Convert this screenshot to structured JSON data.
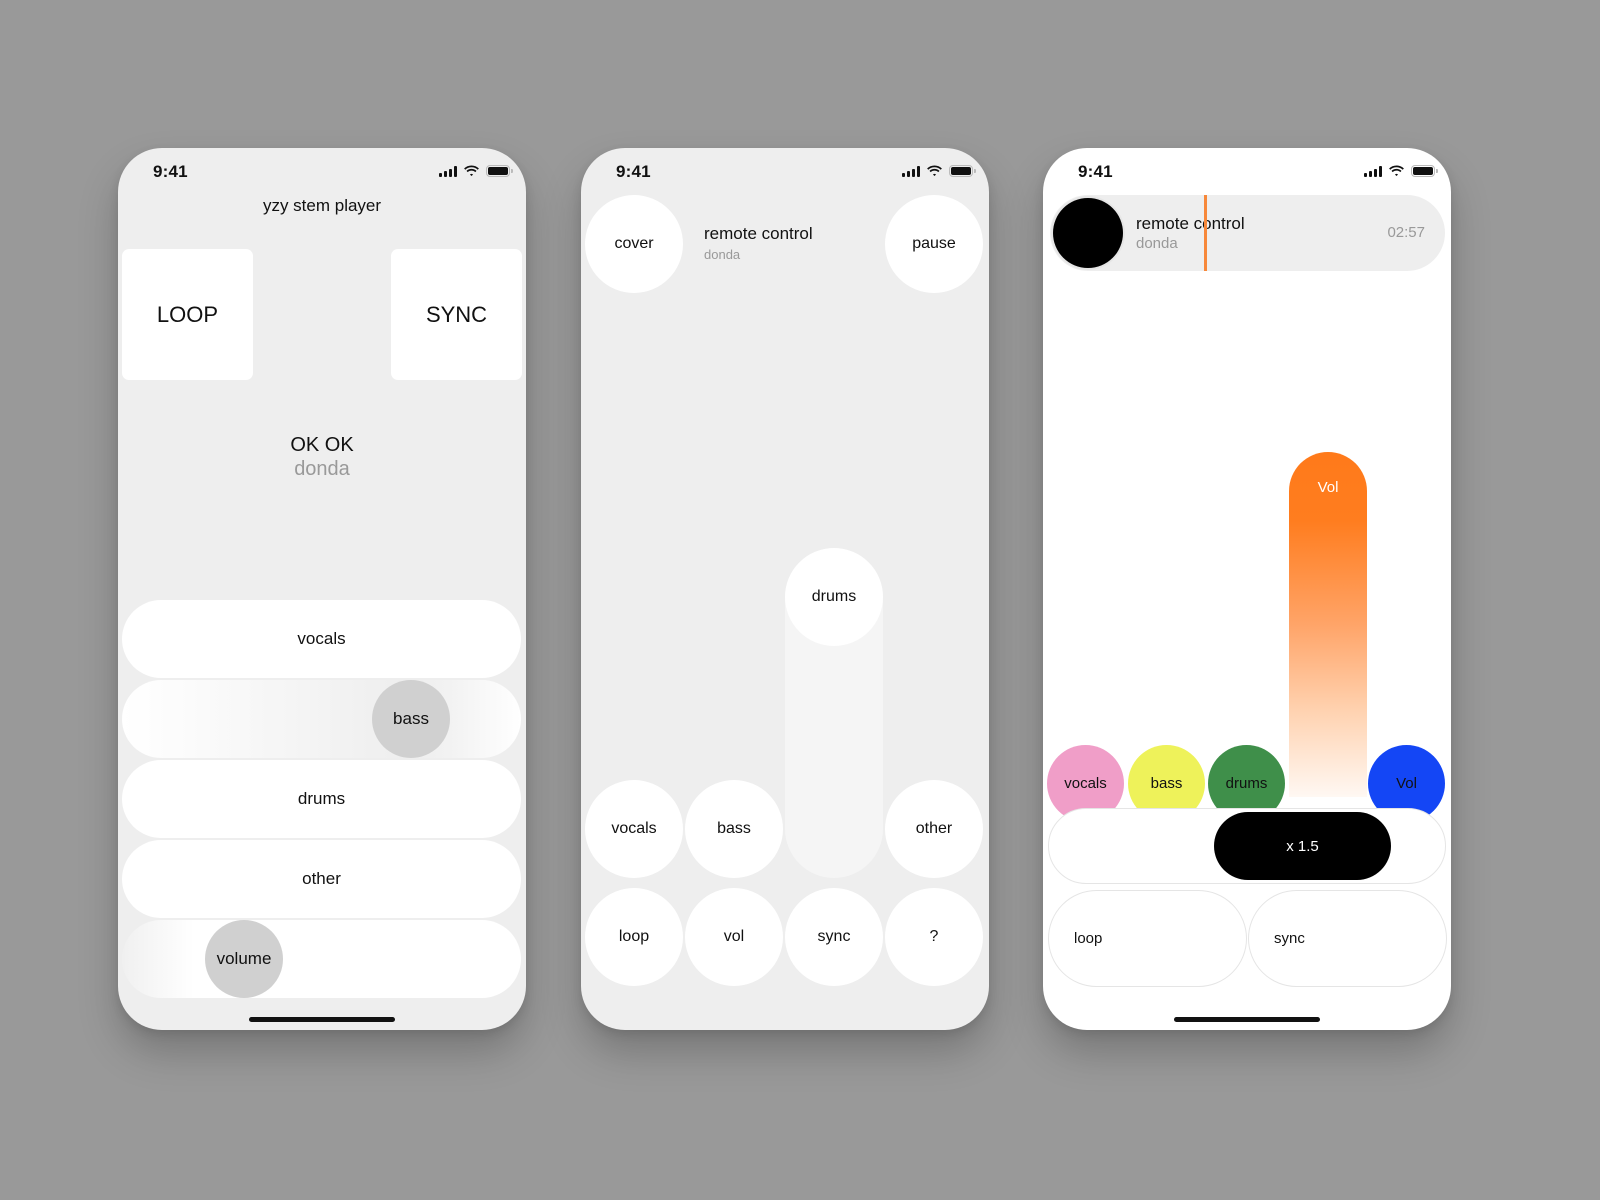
{
  "status_bar": {
    "time": "9:41"
  },
  "screen1": {
    "app_title": "yzy stem player",
    "loop_label": "LOOP",
    "sync_label": "SYNC",
    "track_title": "OK OK",
    "track_artist": "donda",
    "stems": [
      {
        "label": "vocals"
      },
      {
        "label": "bass",
        "level": 0.78
      },
      {
        "label": "drums"
      },
      {
        "label": "other"
      }
    ],
    "volume": {
      "label": "volume",
      "level": 0.26
    }
  },
  "screen2": {
    "cover_label": "cover",
    "track_title": "remote control",
    "track_artist": "donda",
    "pause_label": "pause",
    "drums_slider": {
      "label": "drums",
      "level": 1.0
    },
    "stem_buttons": [
      "vocals",
      "bass",
      "other"
    ],
    "bottom_buttons": [
      "loop",
      "vol",
      "sync",
      "?"
    ]
  },
  "screen3": {
    "track_title": "remote control",
    "track_artist": "donda",
    "time": "02:57",
    "progress": 0.28,
    "vol_slider_label": "Vol",
    "stem_dots": [
      {
        "label": "vocals",
        "color": "#f09ec8"
      },
      {
        "label": "bass",
        "color": "#eef25a"
      },
      {
        "label": "drums",
        "color": "#3f8f4a"
      },
      {
        "label": "Vol",
        "color": "#1446f5"
      }
    ],
    "speed_label": "x 1.5",
    "loop_label": "loop",
    "sync_label": "sync",
    "accent_color": "#ff7a1a"
  }
}
